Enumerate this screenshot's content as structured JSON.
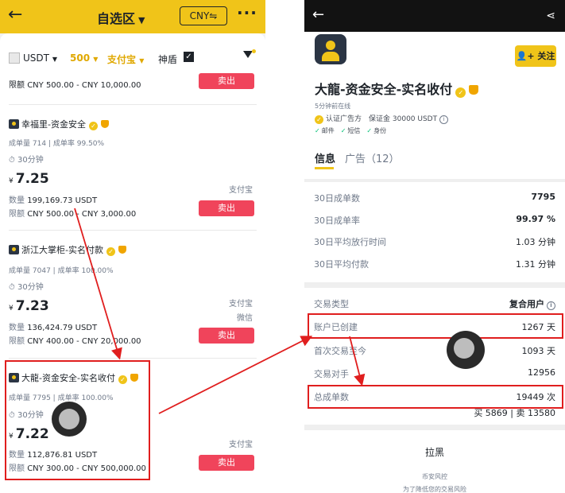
{
  "left": {
    "header": {
      "title": "自选区",
      "currency": "CNY⇋",
      "back_icon": "back-arrow-icon",
      "more_icon": "more-dots-icon"
    },
    "filters": {
      "asset": "USDT",
      "amount": "500",
      "payment": "支付宝",
      "shield_label": "神盾",
      "shield_checked": true
    },
    "partial": {
      "limit_label": "限额",
      "limit": "CNY 500.00 - CNY 10,000.00",
      "button": "卖出"
    },
    "ads": [
      {
        "name": "幸福里-资金安全",
        "orders_label": "成单量",
        "orders": "714",
        "rate_label": "成单率",
        "rate": "99.50%",
        "time": "30分钟",
        "currency_symbol": "¥",
        "price": "7.25",
        "qty_label": "数量",
        "qty": "199,169.73 USDT",
        "limit_label": "限额",
        "limit": "CNY 500.00 - CNY 3,000.00",
        "payments": [
          "支付宝"
        ],
        "button": "卖出"
      },
      {
        "name": "浙江大掌柜-实名付款",
        "orders_label": "成单量",
        "orders": "7047",
        "rate_label": "成单率",
        "rate": "100.00%",
        "time": "30分钟",
        "currency_symbol": "¥",
        "price": "7.23",
        "qty_label": "数量",
        "qty": "136,424.79 USDT",
        "limit_label": "限额",
        "limit": "CNY 400.00 - CNY 20,000.00",
        "payments": [
          "支付宝",
          "微信"
        ],
        "button": "卖出"
      },
      {
        "name": "大龍-资金安全-实名收付",
        "orders_label": "成单量",
        "orders": "7795",
        "rate_label": "成单率",
        "rate": "100.00%",
        "time": "30分钟",
        "currency_symbol": "¥",
        "price": "7.22",
        "qty_label": "数量",
        "qty": "112,876.81 USDT",
        "limit_label": "限额",
        "limit": "CNY 300.00 - CNY 500,000.00",
        "payments": [
          "支付宝"
        ],
        "button": "卖出"
      }
    ]
  },
  "right": {
    "header": {
      "back_icon": "back-arrow-icon",
      "share_icon": "share-icon"
    },
    "profile": {
      "follow": "关注",
      "name": "大龍-资金安全-实名收付",
      "online": "5分钟前在线",
      "certified": "认证广告方",
      "deposit": "保证金 30000 USDT",
      "verifications": [
        "邮件",
        "短信",
        "身份"
      ]
    },
    "tabs": [
      {
        "label": "信息"
      },
      {
        "label": "广告（12）"
      }
    ],
    "stats": [
      {
        "label": "30日成单数",
        "value": "7795"
      },
      {
        "label": "30日成单率",
        "value": "99.97 %"
      },
      {
        "label": "30日平均放行时间",
        "value": "1.03 分钟"
      },
      {
        "label": "30日平均付款",
        "value": "1.31 分钟"
      }
    ],
    "details": [
      {
        "label": "交易类型",
        "value": "复合用户"
      },
      {
        "label": "账户已创建",
        "value": "1267 天"
      },
      {
        "label": "首次交易至今",
        "value": "1093 天"
      },
      {
        "label": "交易对手",
        "value": "12956"
      },
      {
        "label": "总成单数",
        "value": "19449 次"
      }
    ],
    "buy_sell": "买 5869 | 卖 13580",
    "blacklist": {
      "label": "拉黑",
      "risk": "币安风控",
      "note": "为了降低您的交易风险"
    }
  }
}
